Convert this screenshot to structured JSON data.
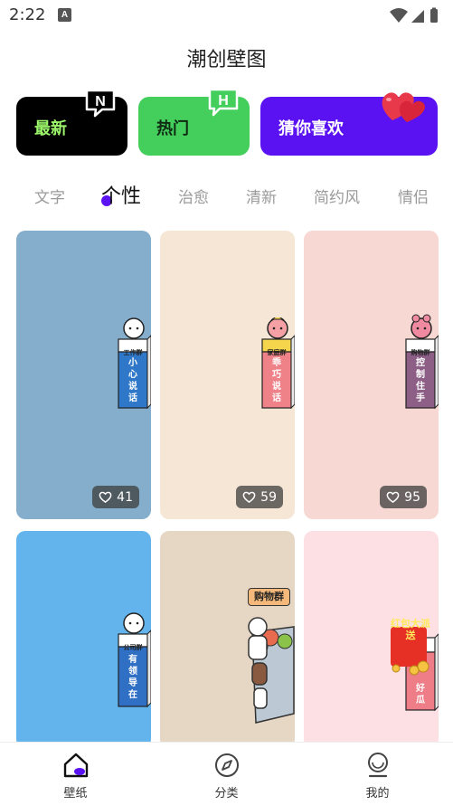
{
  "status_bar": {
    "time": "2:22",
    "app_badge": "A"
  },
  "page_title": "潮创壁图",
  "categories": [
    {
      "label": "最新",
      "badge": "N",
      "color": "#000000"
    },
    {
      "label": "热门",
      "badge": "H",
      "color": "#44cf5c"
    },
    {
      "label": "猜你喜欢",
      "badge": "heart-icon",
      "color": "#5b12f2"
    }
  ],
  "tabs": [
    "文字",
    "个性",
    "治愈",
    "清新",
    "简约风",
    "情侣"
  ],
  "active_tab": "个性",
  "wallpapers": [
    {
      "bg": "#84aecc",
      "likes": "41",
      "group": "工作群",
      "slogan": [
        "小",
        "心",
        "说",
        "话"
      ]
    },
    {
      "bg": "#f6e6d6",
      "likes": "59",
      "group": "家庭群",
      "slogan": [
        "乖",
        "巧",
        "说",
        "话"
      ]
    },
    {
      "bg": "#f7d8d2",
      "likes": "95",
      "group": "购物群",
      "slogan": [
        "控",
        "制",
        "住",
        "手"
      ]
    },
    {
      "bg": "#63b3ec",
      "likes": "",
      "group": "公司群",
      "slogan": [
        "有",
        "领",
        "导",
        "在"
      ]
    },
    {
      "bg": "#e6d7c5",
      "likes": "",
      "group": "购物群",
      "slogan": []
    },
    {
      "bg": "#fce0e4",
      "likes": "",
      "group": "红包大派送",
      "slogan": [
        "好",
        "瓜"
      ]
    }
  ],
  "bottom_nav": [
    {
      "label": "壁纸",
      "icon": "home-icon"
    },
    {
      "label": "分类",
      "icon": "compass-icon"
    },
    {
      "label": "我的",
      "icon": "profile-icon"
    }
  ]
}
